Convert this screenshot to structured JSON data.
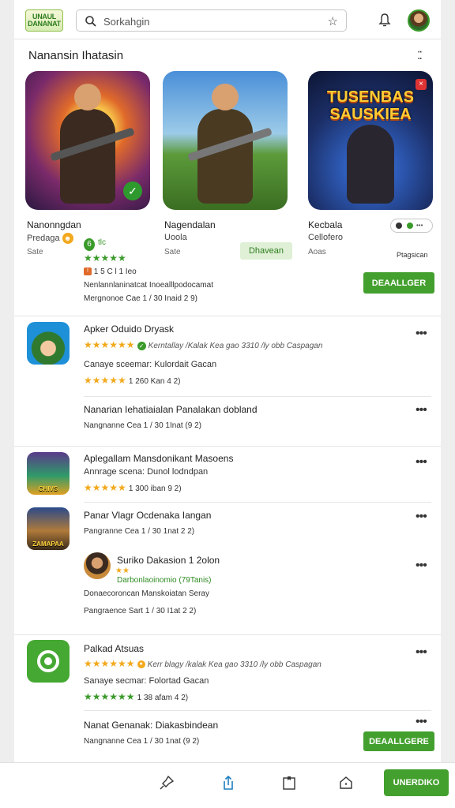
{
  "header": {
    "logo_text": "UNAUL DANANAT",
    "search_placeholder": "Sorkahgin",
    "colors": {
      "accent": "#43a02e",
      "star": "#f2a91c"
    }
  },
  "featured": {
    "title": "Nanansin Ihatasin",
    "more_icon": "grid-dots-icon",
    "cards": [
      {
        "name": "Nanonngdan",
        "sub": "Predaga",
        "size": "Sate",
        "stars": "★★★★★",
        "line1": "Nenlannlaninatcat Inoealllpodocamat",
        "line2": "Mergnonoe Cae 1 / 30 Inaid 2 9)"
      },
      {
        "name": "Nagendalan",
        "sub": "Uoola",
        "size": "Sate",
        "pill": "Dhavean"
      },
      {
        "name": "Kecbala",
        "sub": "Cellofero",
        "size": "Aoas",
        "art_text": "TUSENBAS SAUSKIEA",
        "right_label": "Ptagsican",
        "button": "DEAALLGER"
      }
    ],
    "rank_badge": "6",
    "rank_text": "tlc",
    "stat_text": "1 5 C l 1 Ieo"
  },
  "list": [
    {
      "title": "Apker Oduido Dryask",
      "stars": "★★★★★★",
      "review": "Kerntallay /Kalak Kea gao 3310 /ly obb Caspagan",
      "meta": "Canaye sceemar: Kulordait Gacan",
      "meta_stars": "★★★★★",
      "size": "1 260 Kan 4 2)"
    },
    {
      "title": "Nanarian Iehatiaialan Panalakan dobland",
      "meta": "Nangnanne Cea 1 / 30 1Inat (9 2)"
    },
    {
      "title": "Aplegallam Mansdonikant Masoens",
      "meta": "Annrage scena: Dunol lodndpan",
      "meta_stars": "★★★★★",
      "size": "1 300 iban 9 2)",
      "icon_text": "CHIVS"
    },
    {
      "title": "Panar Vlagr Ocdenaka Iangan",
      "meta": "Pangranne Cea 1 / 30 1nat 2 2)",
      "icon_text": "ZAMAPAA"
    },
    {
      "title": "Suriko Dakasion 1 2olon",
      "stars": "★★",
      "green": "Darbonlaoinomio (79Tanis)",
      "meta": "Donaecoroncan Manskoiatan Seray",
      "size": "Pangraence Sart 1 / 30 I1at 2 2)"
    },
    {
      "title": "Palkad Atsuas",
      "stars": "★★★★★★",
      "review": "Kerr blagy /kalak Kea gao 3310 /ly obb Caspagan",
      "meta": "Sanaye secmar: Folortad Gacan",
      "meta_stars": "★★★★★★",
      "size": "1 38 afam 4 2)"
    },
    {
      "title": "Nanat Genanak: Diakasbindean",
      "meta": "Nangnanne Cea 1 / 30 1nat (9 2)",
      "button": "DEAALLGERE"
    }
  ],
  "bottom": {
    "cta": "UNERDIKO",
    "icons": [
      "pin-icon",
      "share-icon",
      "bookmark-icon",
      "home-icon"
    ]
  }
}
